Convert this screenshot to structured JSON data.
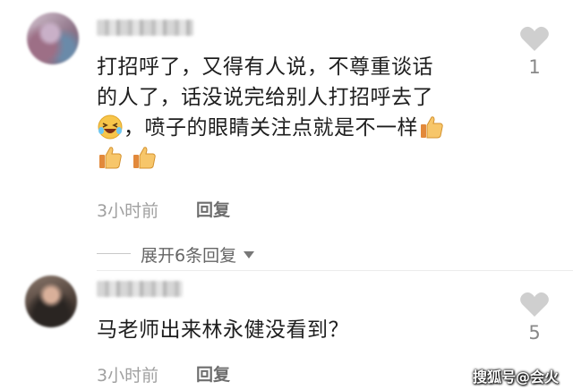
{
  "comments": [
    {
      "text_line1": "打招呼了，又得有人说，不尊重谈话",
      "text_line2": "的人了，话没说完给别人打招呼去了",
      "text_line3": "，喷子的眼睛关注点就是不一样",
      "emojis": [
        "laughing-tears-emoji",
        "thumbs-up-emoji",
        "thumbs-up-emoji",
        "thumbs-up-emoji"
      ],
      "time": "3小时前",
      "reply_label": "回复",
      "likes": "1",
      "expand_label": "展开6条回复"
    },
    {
      "text": "马老师出来林永健没看到？",
      "time": "3小时前",
      "reply_label": "回复",
      "likes": "5"
    }
  ],
  "watermark": "搜狐号@会火",
  "colors": {
    "text": "#1e1e1e",
    "meta": "#a0a0a0",
    "heart": "#cfcfcf",
    "emoji_yellow": "#f7c54a"
  }
}
